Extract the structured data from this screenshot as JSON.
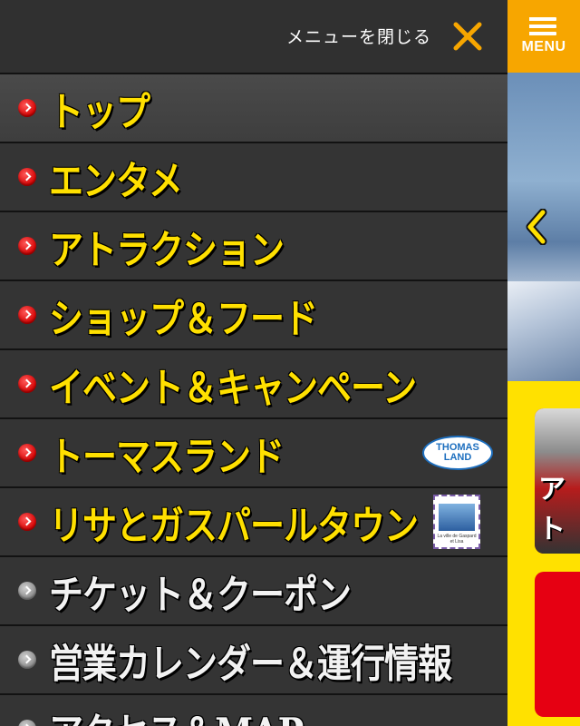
{
  "header": {
    "close_text": "メニューを閉じる",
    "menu_label": "MENU"
  },
  "menu_items": [
    {
      "label": "トップ",
      "color": "yellow",
      "bullet": "red"
    },
    {
      "label": "エンタメ",
      "color": "yellow",
      "bullet": "red"
    },
    {
      "label": "アトラクション",
      "color": "yellow",
      "bullet": "red"
    },
    {
      "label": "ショップ＆フード",
      "color": "yellow",
      "bullet": "red"
    },
    {
      "label": "イベント＆キャンペーン",
      "color": "yellow",
      "bullet": "red"
    },
    {
      "label": "トーマスランド",
      "color": "yellow",
      "bullet": "red",
      "badge": "THOMAS LAND"
    },
    {
      "label": "リサとガスパールタウン",
      "color": "yellow",
      "bullet": "red",
      "badge": "La ville de Gaspard et Lisa"
    },
    {
      "label": "チケット＆クーポン",
      "color": "white",
      "bullet": "grey"
    },
    {
      "label": "営業カレンダー＆運行情報",
      "color": "white",
      "bullet": "grey"
    },
    {
      "label": "アクセス＆MAP",
      "color": "white",
      "bullet": "grey"
    }
  ],
  "background": {
    "card_text": "アト"
  },
  "colors": {
    "accent_yellow": "#ffe000",
    "menu_button_orange": "#f7a600",
    "close_x_orange": "#f7a600",
    "panel_bg": "#2b2b2b",
    "page_yellow": "#ffe100",
    "card_red": "#e60012"
  },
  "icons": {
    "close": "close-x-icon",
    "menu": "hamburger-icon",
    "bullet": "chevron-right-icon",
    "carousel_prev": "chevron-left-icon"
  }
}
